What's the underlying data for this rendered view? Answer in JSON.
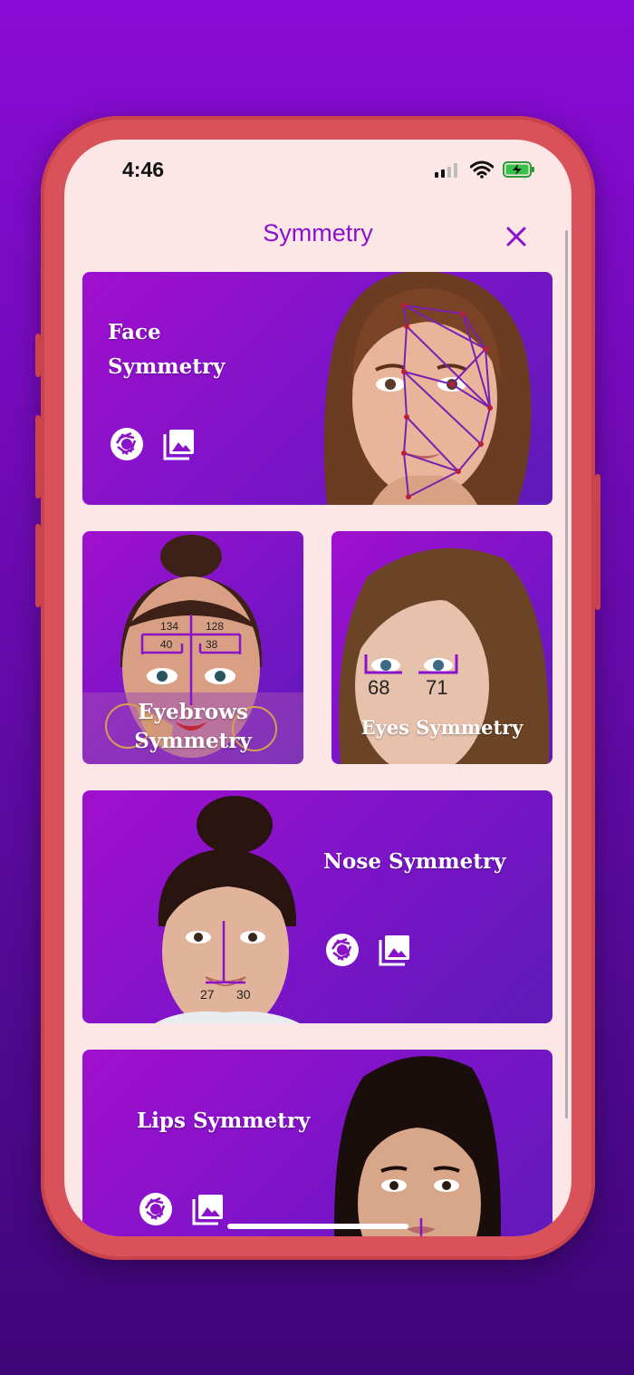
{
  "status_bar": {
    "time": "4:46"
  },
  "header": {
    "title": "Symmetry"
  },
  "cards": {
    "face": {
      "title_line1": "Face",
      "title_line2": "Symmetry"
    },
    "eyebrows": {
      "title_line1": "Eyebrows",
      "title_line2": "Symmetry",
      "labels": [
        "134",
        "128",
        "40",
        "38"
      ]
    },
    "eyes": {
      "title": "Eyes Symmetry",
      "labels": [
        "68",
        "71"
      ]
    },
    "nose": {
      "title": "Nose Symmetry",
      "labels": [
        "27",
        "30"
      ]
    },
    "lips": {
      "title": "Lips Symmetry"
    }
  },
  "icons": {
    "camera": "camera-aperture-icon",
    "gallery": "gallery-icon",
    "close": "close-icon"
  },
  "colors": {
    "accent": "#8a12c9",
    "card_gradient_start": "#a10fcf",
    "card_gradient_end": "#5e1ab8",
    "screen_bg": "#fde6e6",
    "phone_frame": "#d9525a"
  }
}
